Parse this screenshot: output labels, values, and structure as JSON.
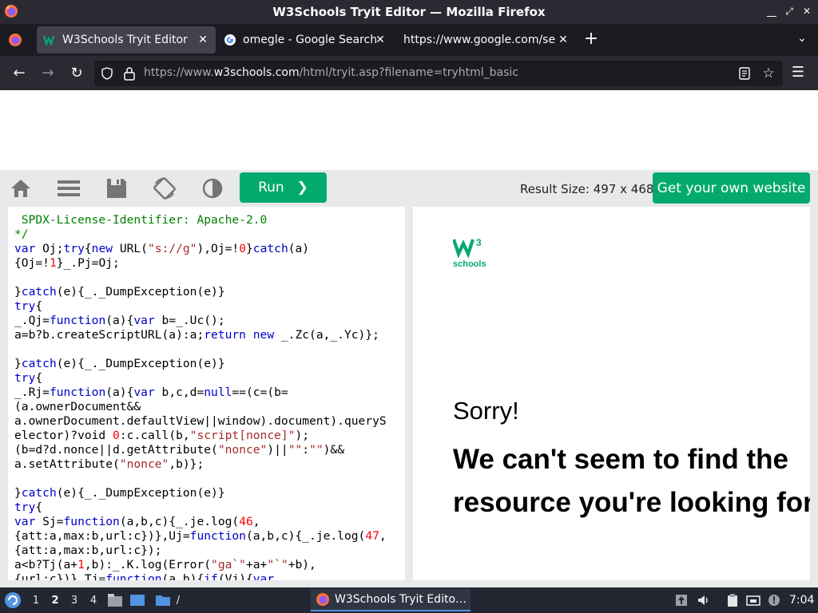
{
  "window": {
    "title": "W3Schools Tryit Editor — Mozilla Firefox"
  },
  "tabs": [
    {
      "label": "W3Schools Tryit Editor",
      "active": true
    },
    {
      "label": "omegle - Google Search",
      "active": false
    },
    {
      "label": "https://www.google.com/sea",
      "active": false
    }
  ],
  "address": {
    "prefix": "https://www.",
    "host": "w3schools.com",
    "path": "/html/tryit.asp?filename=tryhtml_basic"
  },
  "toolbar": {
    "run_label": "Run",
    "run_chevron": "❯",
    "result_size": "Result Size: 497 x 468",
    "get_website_label": "Get your own website"
  },
  "code_lines": [
    [
      {
        "t": " SPDX-License-Identifier: Apache-2.0",
        "c": "cm"
      }
    ],
    [
      {
        "t": "*/",
        "c": "cm"
      }
    ],
    [
      {
        "t": "var",
        "c": "kw"
      },
      {
        "t": " Oj;"
      },
      {
        "t": "try",
        "c": "kw"
      },
      {
        "t": "{"
      },
      {
        "t": "new",
        "c": "kw"
      },
      {
        "t": " URL("
      },
      {
        "t": "\"s://g\"",
        "c": "str"
      },
      {
        "t": "),Oj=!"
      },
      {
        "t": "0",
        "c": "num"
      },
      {
        "t": "}"
      },
      {
        "t": "catch",
        "c": "kw"
      },
      {
        "t": "(a)"
      }
    ],
    [
      {
        "t": "{Oj=!"
      },
      {
        "t": "1",
        "c": "num"
      },
      {
        "t": "}_.Pj=Oj;"
      }
    ],
    [
      {
        "t": ""
      }
    ],
    [
      {
        "t": "}"
      },
      {
        "t": "catch",
        "c": "kw"
      },
      {
        "t": "(e){_._DumpException(e)}"
      }
    ],
    [
      {
        "t": "try",
        "c": "kw"
      },
      {
        "t": "{"
      }
    ],
    [
      {
        "t": "_.Qj="
      },
      {
        "t": "function",
        "c": "kw"
      },
      {
        "t": "(a){"
      },
      {
        "t": "var",
        "c": "kw"
      },
      {
        "t": " b=_.Uc();"
      }
    ],
    [
      {
        "t": "a=b?b.createScriptURL(a):a;"
      },
      {
        "t": "return",
        "c": "kw"
      },
      {
        "t": " "
      },
      {
        "t": "new",
        "c": "kw"
      },
      {
        "t": " _.Zc(a,_.Yc)};"
      }
    ],
    [
      {
        "t": ""
      }
    ],
    [
      {
        "t": "}"
      },
      {
        "t": "catch",
        "c": "kw"
      },
      {
        "t": "(e){_._DumpException(e)}"
      }
    ],
    [
      {
        "t": "try",
        "c": "kw"
      },
      {
        "t": "{"
      }
    ],
    [
      {
        "t": "_.Rj="
      },
      {
        "t": "function",
        "c": "kw"
      },
      {
        "t": "(a){"
      },
      {
        "t": "var",
        "c": "kw"
      },
      {
        "t": " b,c,d="
      },
      {
        "t": "null",
        "c": "kw"
      },
      {
        "t": "==(c=(b="
      }
    ],
    [
      {
        "t": "(a.ownerDocument&&"
      }
    ],
    [
      {
        "t": "a.ownerDocument.defaultView||window).document).queryS"
      }
    ],
    [
      {
        "t": "elector)?void "
      },
      {
        "t": "0",
        "c": "num"
      },
      {
        "t": ":c.call(b,"
      },
      {
        "t": "\"script[nonce]\"",
        "c": "str"
      },
      {
        "t": ");"
      }
    ],
    [
      {
        "t": "(b=d?d.nonce||d.getAttribute("
      },
      {
        "t": "\"nonce\"",
        "c": "str"
      },
      {
        "t": ")||"
      },
      {
        "t": "\"\"",
        "c": "str"
      },
      {
        "t": ":"
      },
      {
        "t": "\"\"",
        "c": "str"
      },
      {
        "t": ")&&"
      }
    ],
    [
      {
        "t": "a.setAttribute("
      },
      {
        "t": "\"nonce\"",
        "c": "str"
      },
      {
        "t": ",b)};"
      }
    ],
    [
      {
        "t": ""
      }
    ],
    [
      {
        "t": "}"
      },
      {
        "t": "catch",
        "c": "kw"
      },
      {
        "t": "(e){_._DumpException(e)}"
      }
    ],
    [
      {
        "t": "try",
        "c": "kw"
      },
      {
        "t": "{"
      }
    ],
    [
      {
        "t": "var",
        "c": "kw"
      },
      {
        "t": " Sj="
      },
      {
        "t": "function",
        "c": "kw"
      },
      {
        "t": "(a,b,c){_.je.log("
      },
      {
        "t": "46",
        "c": "num"
      },
      {
        "t": ","
      }
    ],
    [
      {
        "t": "{att:a,max:b,url:c})},Uj="
      },
      {
        "t": "function",
        "c": "kw"
      },
      {
        "t": "(a,b,c){_.je.log("
      },
      {
        "t": "47",
        "c": "num"
      },
      {
        "t": ","
      }
    ],
    [
      {
        "t": "{att:a,max:b,url:c});"
      }
    ],
    [
      {
        "t": "a<b?Tj(a+"
      },
      {
        "t": "1",
        "c": "num"
      },
      {
        "t": ",b):_.K.log(Error("
      },
      {
        "t": "\"ga`\"",
        "c": "str"
      },
      {
        "t": "+a+"
      },
      {
        "t": "\"`\"",
        "c": "str"
      },
      {
        "t": "+b),"
      }
    ],
    [
      {
        "t": "{url:c})},Tj="
      },
      {
        "t": "function",
        "c": "kw"
      },
      {
        "t": "(a,b){"
      },
      {
        "t": "if",
        "c": "kw"
      },
      {
        "t": "(Vj){"
      },
      {
        "t": "var",
        "c": "kw"
      }
    ]
  ],
  "result": {
    "logo_text": "schools",
    "logo_sup": "3",
    "sorry": "Sorry!",
    "message": "We can't seem to find the resource you're looking for."
  },
  "taskbar": {
    "workspaces": [
      "1",
      "2",
      "3",
      "4"
    ],
    "active_workspace": "2",
    "folder_label": "/",
    "task_label": "W3Schools Tryit Edito…",
    "clock": "7:04"
  },
  "colors": {
    "w3_green": "#04aa6d",
    "firefox_dark": "#2b2a33",
    "code_keyword": "#0000cd",
    "code_string": "#a52a2a",
    "code_number": "#ff0000",
    "code_comment": "#008000"
  }
}
